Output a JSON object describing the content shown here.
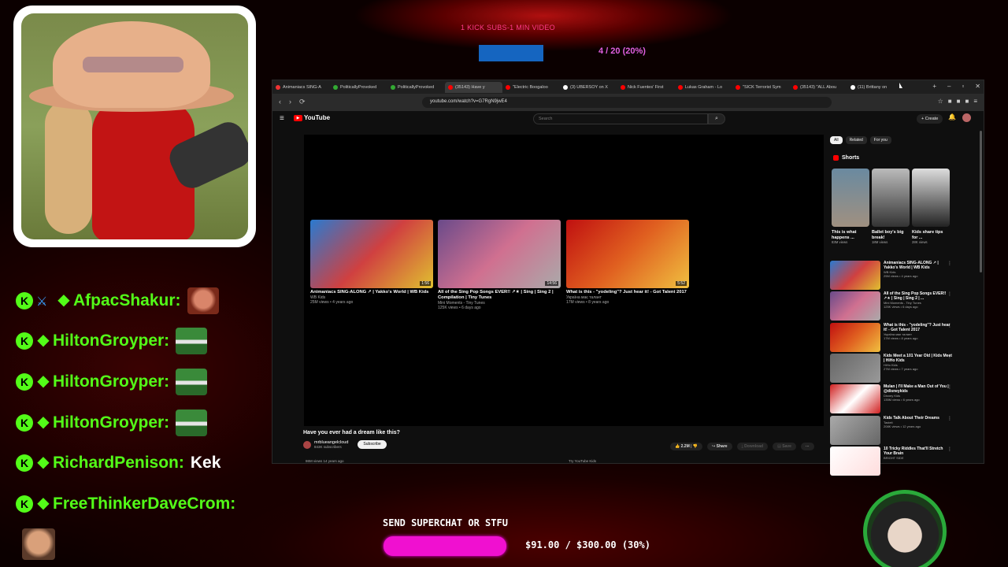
{
  "overlay": {
    "kick_goal_label": "1 KICK SUBS-1 MIN VIDEO",
    "kick_goal_progress": "4 / 20 (20%)",
    "kick_goal_fraction": 0.2,
    "superchat_label": "SEND SUPERCHAT OR STFU",
    "superchat_amount": "$91.00 / $300.00 (30%)",
    "superchat_fraction": 0.3
  },
  "chat": [
    {
      "user": "AfpacShakur:",
      "badges": [
        "kick-badge",
        "sword-icon",
        "diamond-icon"
      ],
      "message": "",
      "emote": "face-emote"
    },
    {
      "user": "HiltonGroyper:",
      "badges": [
        "kick-badge",
        "diamond-icon"
      ],
      "message": "",
      "emote": "pepe-emote"
    },
    {
      "user": "HiltonGroyper:",
      "badges": [
        "kick-badge",
        "diamond-icon"
      ],
      "message": "",
      "emote": "pepe-emote"
    },
    {
      "user": "HiltonGroyper:",
      "badges": [
        "kick-badge",
        "diamond-icon"
      ],
      "message": "",
      "emote": "pepe-emote"
    },
    {
      "user": "RichardPenison:",
      "badges": [
        "kick-badge",
        "diamond-icon"
      ],
      "message": "Kek",
      "emote": ""
    },
    {
      "user": "FreeThinkerDaveCrom:",
      "badges": [
        "kick-badge",
        "diamond-icon"
      ],
      "message": "",
      "emote": "laugh-emote"
    }
  ],
  "browser": {
    "tabs": [
      {
        "label": "Animaniacs SING-A",
        "color": "#e33"
      },
      {
        "label": "PoliticallyProvoked",
        "color": "#3a3"
      },
      {
        "label": "PoliticallyProvoked",
        "color": "#3a3"
      },
      {
        "label": "(35143) Have y",
        "color": "#f00",
        "active": true
      },
      {
        "label": "\"Electric Boogaloo",
        "color": "#f00"
      },
      {
        "label": "(3) UBERSOY on X",
        "color": "#fff"
      },
      {
        "label": "Nick Fuentes' First",
        "color": "#f00"
      },
      {
        "label": "Lukas Graham - Lo",
        "color": "#f00"
      },
      {
        "label": "\"SICK Terrorist Sym",
        "color": "#f00"
      },
      {
        "label": "(35143) \"ALL Abou",
        "color": "#f00"
      },
      {
        "label": "(11) Brittany on",
        "color": "#fff"
      }
    ],
    "url": "youtube.com/watch?v=G7RgN9jwE4"
  },
  "youtube": {
    "logo": "YouTube",
    "search_placeholder": "Search",
    "create_label": "+ Create",
    "video_title": "Have you ever had a dream like this?",
    "channel": "mrblueangelcloud",
    "channel_subs": "843K subscribers",
    "subscribe_label": "Subscribe",
    "likes": "2.2M",
    "share_label": "Share",
    "download_label": "Download",
    "save_label": "Save",
    "below_left": "86M views  14 years ago",
    "below_right": "Try YouTube Kids",
    "endcards": [
      {
        "title": "Animaniacs SING-ALONG ↗ | Yakko's World | WB Kids",
        "meta1": "WB Kids",
        "meta2": "25M views • 4 years ago",
        "color": "linear-gradient(135deg,#2a7ad0,#d04040,#e0c030)",
        "dur": "1:56"
      },
      {
        "title": "All of the Sing Pop Songs EVER!! ↗★ | Sing | Sing 2 | Compilation | Tiny Tunes",
        "meta1": "Mini Moments - Tiny Tunes",
        "meta2": "125K views • 6 days ago",
        "color": "linear-gradient(135deg,#6a4a8a,#d07090,#aaa)",
        "dur": "14:56"
      },
      {
        "title": "What is this - \"yodeling\"? Just hear it! - Got Talent 2017",
        "meta1": "Україна має талант",
        "meta2": "17M views • 8 years ago",
        "color": "linear-gradient(135deg,#c01010,#e06020,#f0c040)",
        "dur": "5:52"
      }
    ],
    "chips": [
      "All",
      "Related",
      "For you"
    ],
    "shorts_label": "Shorts",
    "shorts": [
      {
        "title": "This is what happens ...",
        "meta": "83M views",
        "color": "linear-gradient(180deg,#6a8aa0,#a09080)"
      },
      {
        "title": "Ballet boy's big break!",
        "meta": "18M views",
        "color": "linear-gradient(180deg,#bbb,#333)"
      },
      {
        "title": "Kids share tips for ...",
        "meta": "28K views",
        "color": "linear-gradient(180deg,#ddd,#222)"
      }
    ],
    "related": [
      {
        "title": "Animaniacs SING-ALONG ↗ | Yakko's World | WB Kids",
        "meta1": "WB Kids",
        "meta2": "25M views • 4 years ago",
        "color": "linear-gradient(135deg,#2a7ad0,#d04040,#e0c030)"
      },
      {
        "title": "All of the Sing Pop Songs EVER!! ↗★ | Sing | Sing 2 | ...",
        "meta1": "Mini Moments - Tiny Tunes",
        "meta2": "125K views • 6 days ago",
        "color": "linear-gradient(135deg,#6a4a8a,#d07090,#aaa)"
      },
      {
        "title": "What is this - \"yodeling\"? Just hear it! - Got Talent 2017",
        "meta1": "Україна має талант",
        "meta2": "17M views • 8 years ago",
        "color": "linear-gradient(135deg,#c01010,#e06020,#f0c040)"
      },
      {
        "title": "Kids Meet a 101 Year Old | Kids Meet | HiHo Kids",
        "meta1": "HiHo Kids",
        "meta2": "27M views • 7 years ago",
        "color": "linear-gradient(135deg,#666,#999)"
      },
      {
        "title": "Mulan | I'll Make a Man Out of You | @disneykids",
        "meta1": "Disney Kids",
        "meta2": "135M views • 6 years ago",
        "color": "linear-gradient(135deg,#d02020,#fff,#d02020)"
      },
      {
        "title": "Kids Talk About Their Dreams",
        "meta1": "Tasteit",
        "meta2": "208K views • 12 years ago",
        "color": "linear-gradient(135deg,#aaa,#666)"
      },
      {
        "title": "10 Tricky Riddles That'll Stretch Your Brain",
        "meta1": "BRIGHT SIDE",
        "meta2": "",
        "color": "linear-gradient(135deg,#fff,#fdd)"
      }
    ]
  }
}
